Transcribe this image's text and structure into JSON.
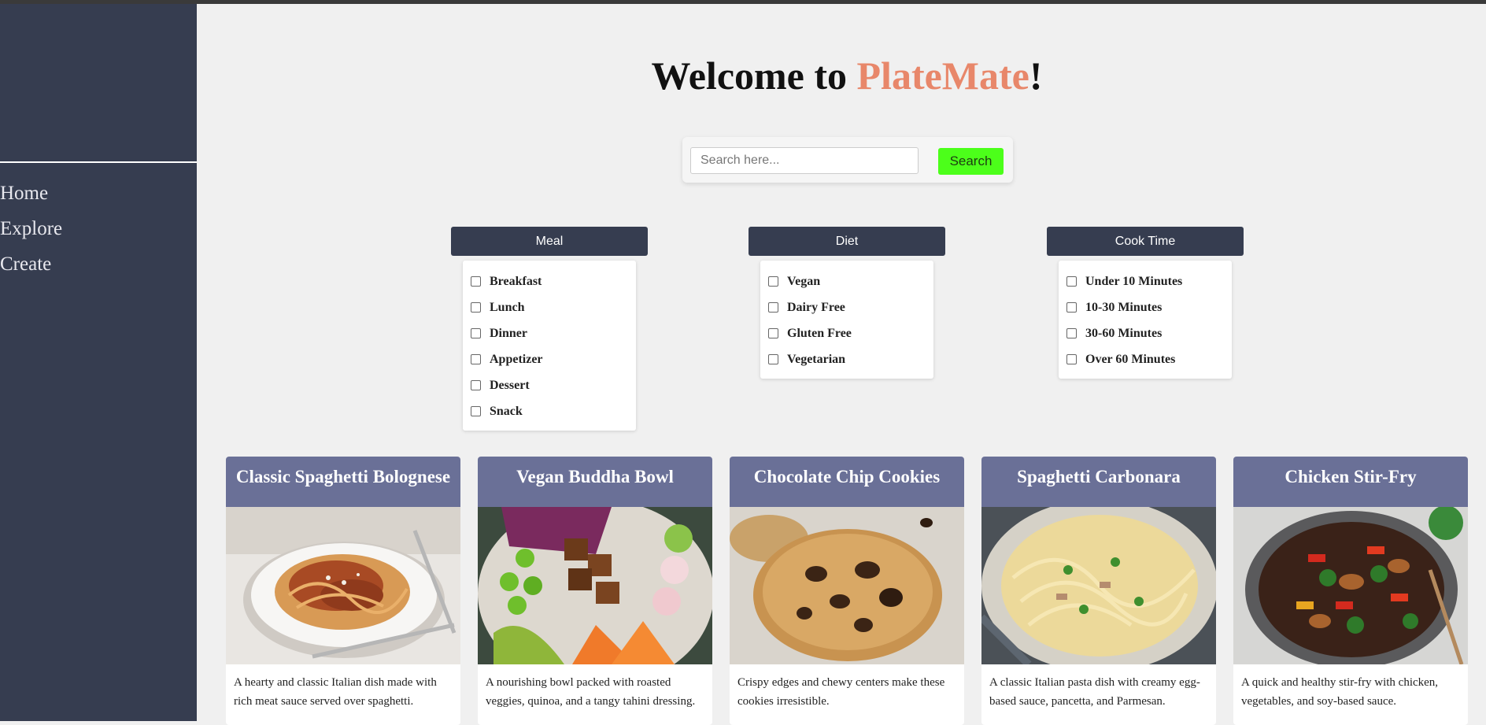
{
  "header": {
    "welcome_prefix": "Welcome to ",
    "brand": "PlateMate",
    "welcome_suffix": "!"
  },
  "sidebar": {
    "items": [
      {
        "label": "Home"
      },
      {
        "label": "Explore"
      },
      {
        "label": "Create"
      }
    ]
  },
  "search": {
    "placeholder": "Search here...",
    "button_label": "Search"
  },
  "filters": [
    {
      "title": "Meal",
      "options": [
        "Breakfast",
        "Lunch",
        "Dinner",
        "Appetizer",
        "Dessert",
        "Snack"
      ]
    },
    {
      "title": "Diet",
      "options": [
        "Vegan",
        "Dairy Free",
        "Gluten Free",
        "Vegetarian"
      ]
    },
    {
      "title": "Cook Time",
      "options": [
        "Under 10 Minutes",
        "10-30 Minutes",
        "30-60 Minutes",
        "Over 60 Minutes"
      ]
    }
  ],
  "recipes": [
    {
      "title": "Classic Spaghetti Bolognese",
      "description": "A hearty and classic Italian dish made with rich meat sauce served over spaghetti.",
      "image": "spaghetti-bolognese-photo"
    },
    {
      "title": "Vegan Buddha Bowl",
      "description": "A nourishing bowl packed with roasted veggies, quinoa, and a tangy tahini dressing.",
      "image": "buddha-bowl-photo"
    },
    {
      "title": "Chocolate Chip Cookies",
      "description": "Crispy edges and chewy centers make these cookies irresistible.",
      "image": "chocolate-chip-cookie-photo"
    },
    {
      "title": "Spaghetti Carbonara",
      "description": "A classic Italian pasta dish with creamy egg-based sauce, pancetta, and Parmesan.",
      "image": "carbonara-photo"
    },
    {
      "title": "Chicken Stir-Fry",
      "description": "A quick and healthy stir-fry with chicken, vegetables, and soy-based sauce.",
      "image": "stir-fry-photo"
    }
  ],
  "colors": {
    "sidebar": "#363d50",
    "brand": "#e8876a",
    "search_button": "#4cff1a",
    "card_header": "#6a7097",
    "page_bg": "#f0f0f0"
  }
}
